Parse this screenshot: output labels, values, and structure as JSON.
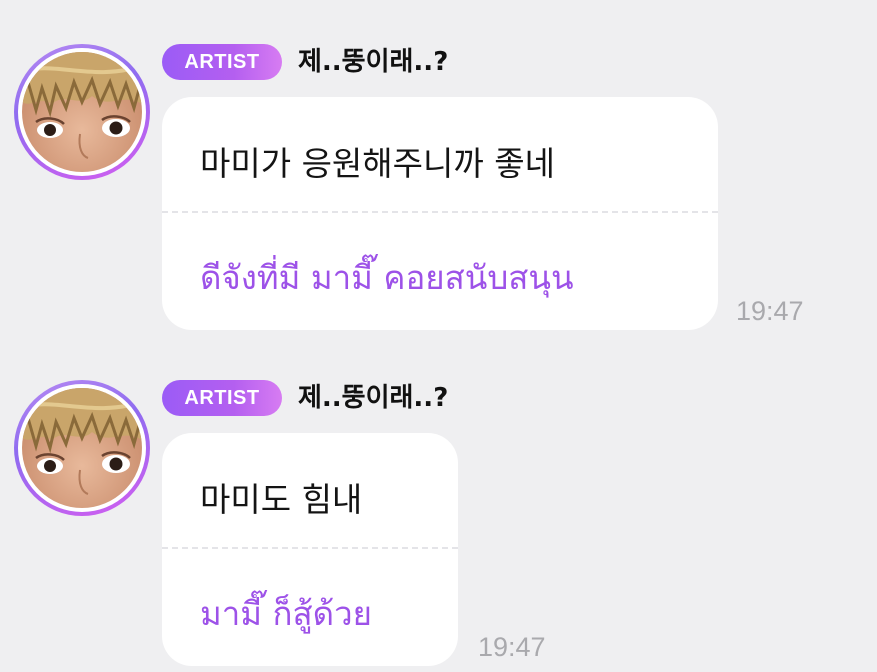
{
  "messages": [
    {
      "badge": "ARTIST",
      "sender": "제..뚱이래..?",
      "original": "마미가 응원해주니까 좋네",
      "translation": "ดีจังที่มี มามี๊ คอยสนับสนุน",
      "time": "19:47"
    },
    {
      "badge": "ARTIST",
      "sender": "제..뚱이래..?",
      "original": "마미도 힘내",
      "translation": "มามี๊ ก็สู้ด้วย",
      "time": "19:47"
    }
  ],
  "colors": {
    "background": "#efeff1",
    "badge_gradient_start": "#9b5cf6",
    "badge_gradient_end": "#d77cf2",
    "translation_text": "#9d52e8",
    "time_text": "#a9a9ad"
  }
}
